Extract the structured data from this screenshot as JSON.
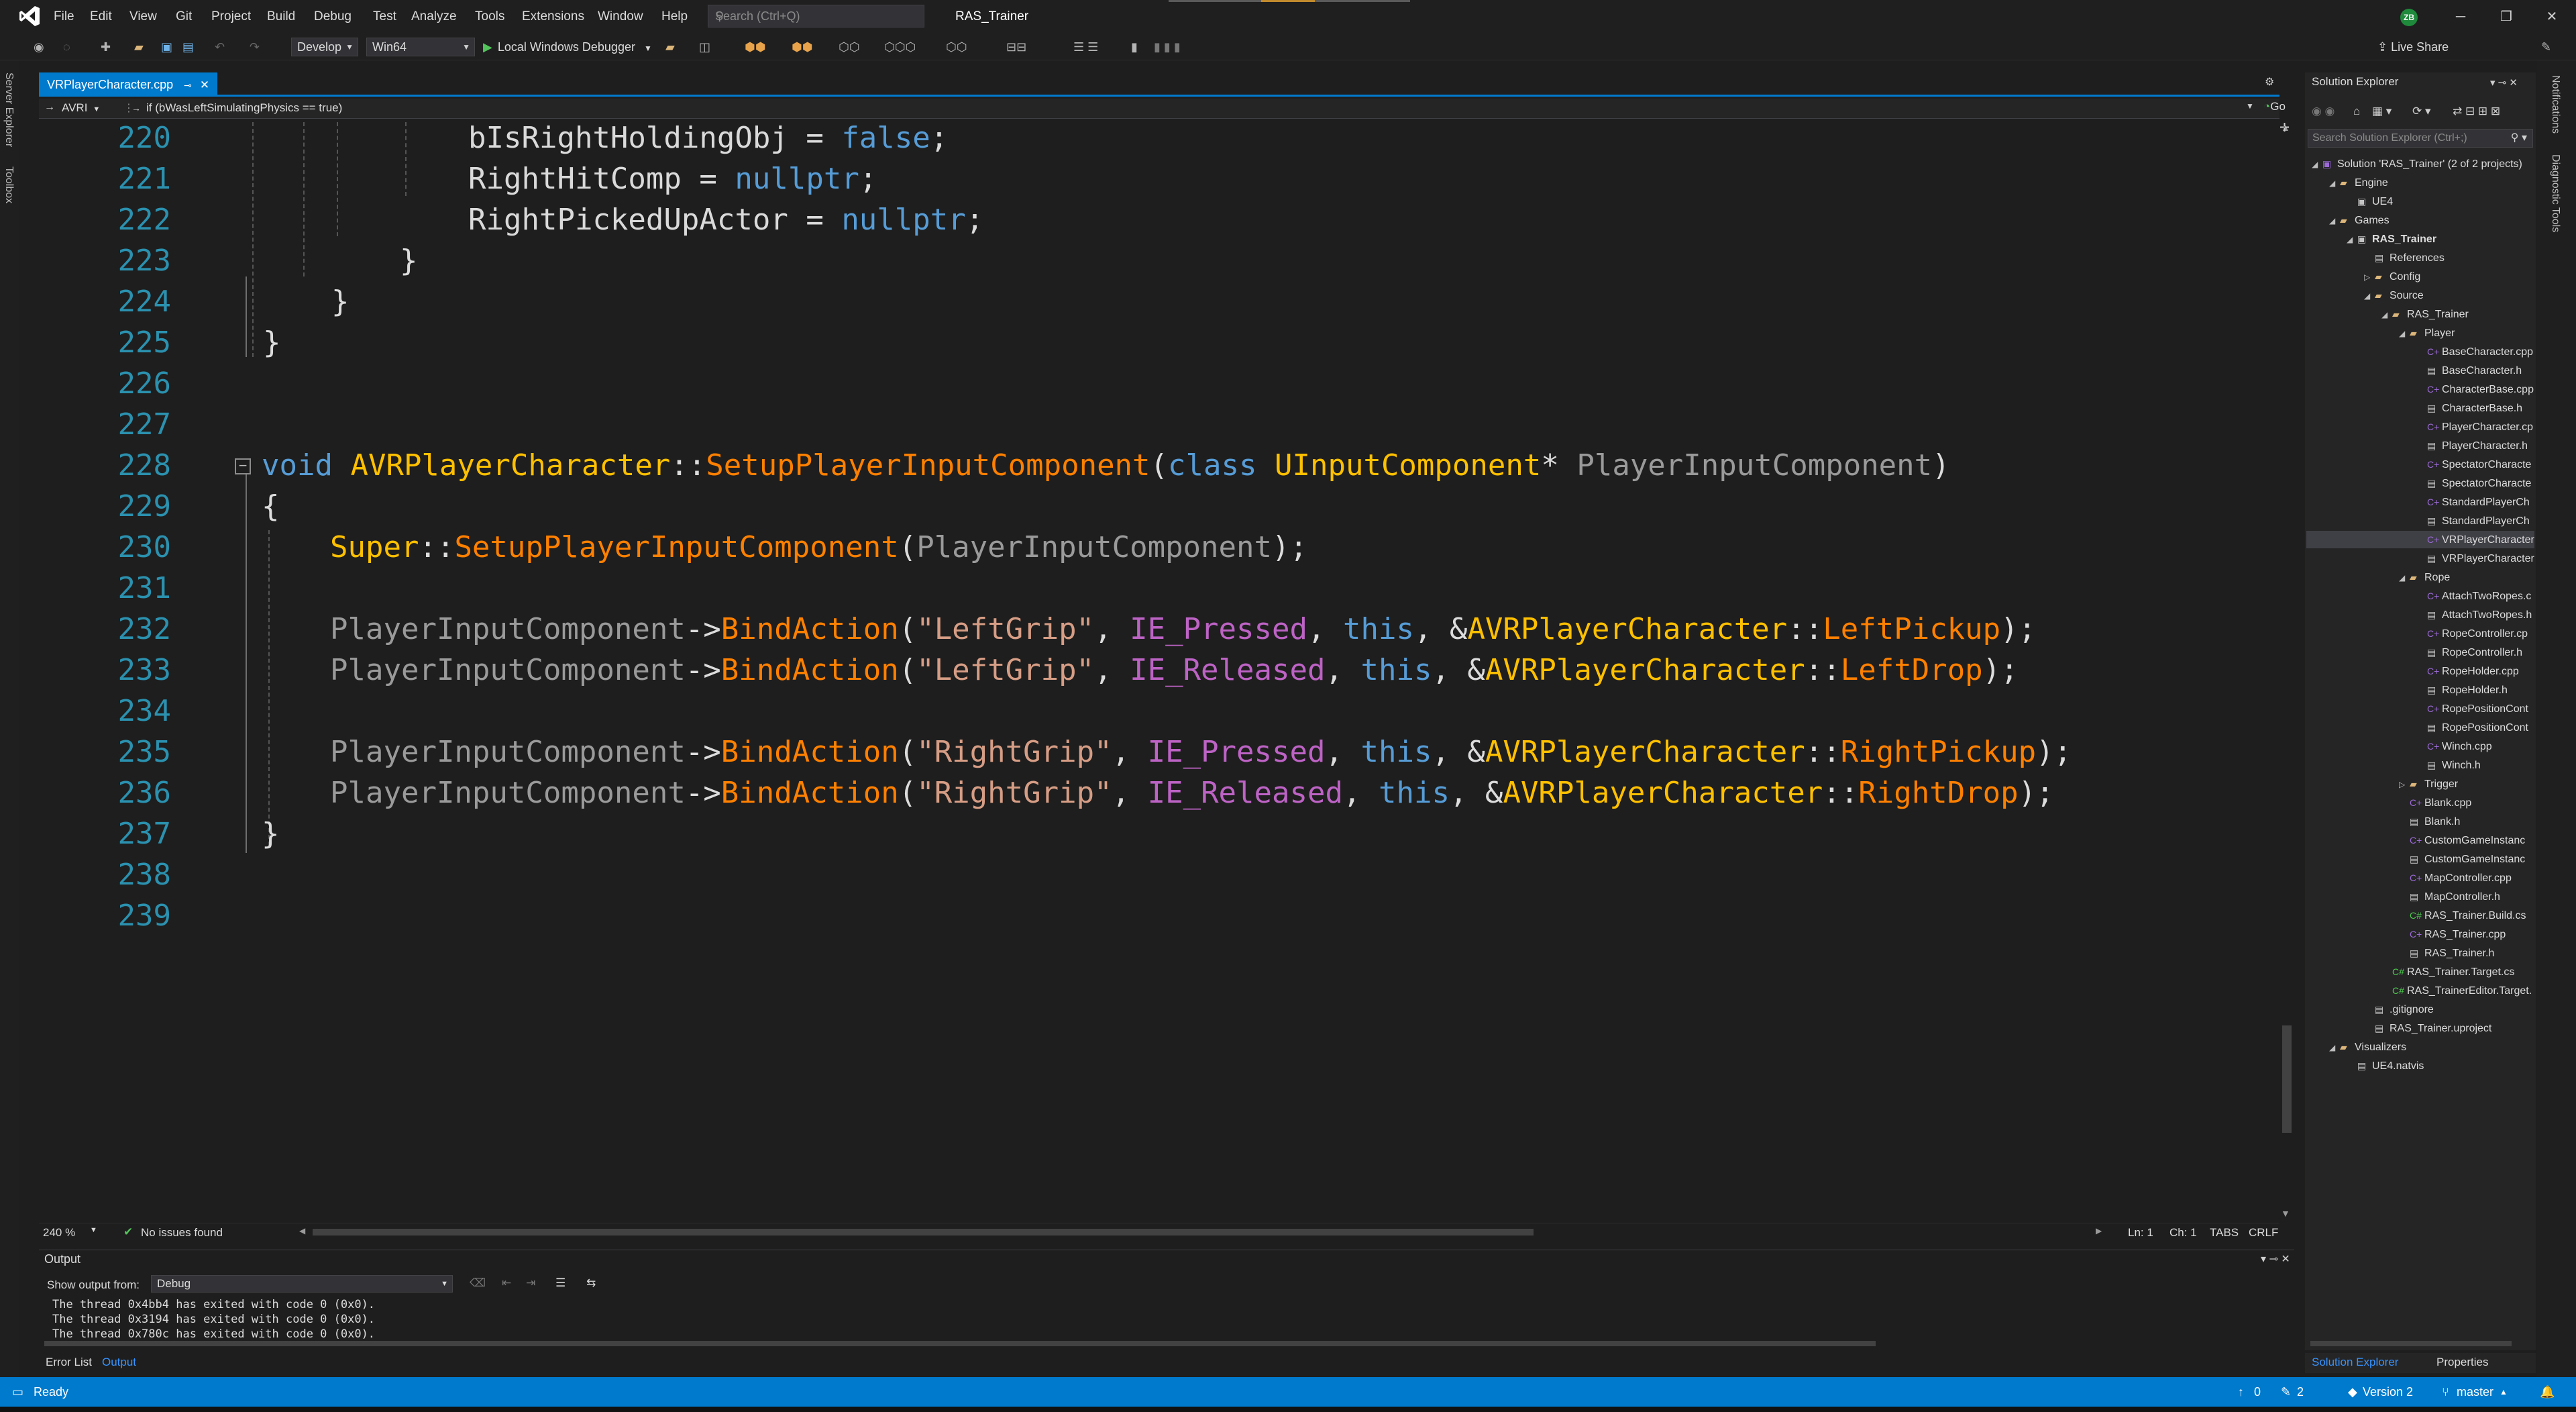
{
  "menu": [
    "File",
    "Edit",
    "View",
    "Git",
    "Project",
    "Build",
    "Debug",
    "Test",
    "Analyze",
    "Tools",
    "Extensions",
    "Window",
    "Help"
  ],
  "search": {
    "placeholder": "Search (Ctrl+Q)"
  },
  "solution_title": "RAS_Trainer",
  "user_initials": "ZB",
  "toolbar": {
    "config": "Develop",
    "platform": "Win64",
    "debugger": "Local Windows Debugger",
    "live_share": "Live Share"
  },
  "left_strip": [
    "Server Explorer",
    "Toolbox"
  ],
  "right_strip": [
    "Notifications",
    "Diagnostic Tools"
  ],
  "doc_tab": {
    "label": "VRPlayerCharacter.cpp"
  },
  "nav": {
    "scope": "AVRI",
    "member": "if (bWasLeftSimulatingPhysics == true)",
    "go": "Go"
  },
  "editor": {
    "line_numbers": [
      "220",
      "221",
      "222",
      "223",
      "224",
      "225",
      "226",
      "227",
      "228",
      "229",
      "230",
      "231",
      "232",
      "233",
      "234",
      "235",
      "236",
      "237",
      "238",
      "239"
    ],
    "zoom": "240 %",
    "issues": "No issues found",
    "position": {
      "line": "Ln: 1",
      "col": "Ch: 1",
      "indent": "TABS",
      "eol": "CRLF"
    }
  },
  "output": {
    "title": "Output",
    "show_from_label": "Show output from:",
    "source": "Debug",
    "lines": [
      "The thread 0x4bb4 has exited with code 0 (0x0).",
      "The thread 0x3194 has exited with code 0 (0x0).",
      "The thread 0x780c has exited with code 0 (0x0)."
    ]
  },
  "bottom_tabs": {
    "error_list": "Error List",
    "output": "Output"
  },
  "solution_explorer": {
    "title": "Solution Explorer",
    "search_placeholder": "Search Solution Explorer (Ctrl+;)",
    "tabs": {
      "explorer": "Solution Explorer",
      "properties": "Properties"
    },
    "tree": [
      {
        "label": "Solution 'RAS_Trainer' (2 of 2 projects)",
        "depth": 0,
        "icon": "sol"
      },
      {
        "label": "Engine",
        "depth": 1,
        "icon": "folder"
      },
      {
        "label": "UE4",
        "depth": 2,
        "icon": "proj"
      },
      {
        "label": "Games",
        "depth": 1,
        "icon": "folder"
      },
      {
        "label": "RAS_Trainer",
        "depth": 2,
        "icon": "proj",
        "bold": true
      },
      {
        "label": "References",
        "depth": 3,
        "icon": "h"
      },
      {
        "label": "Config",
        "depth": 3,
        "icon": "folder"
      },
      {
        "label": "Source",
        "depth": 3,
        "icon": "folder"
      },
      {
        "label": "RAS_Trainer",
        "depth": 4,
        "icon": "folder"
      },
      {
        "label": "Player",
        "depth": 5,
        "icon": "folder"
      },
      {
        "label": "BaseCharacter.cpp",
        "depth": 6,
        "icon": "cpp"
      },
      {
        "label": "BaseCharacter.h",
        "depth": 6,
        "icon": "h"
      },
      {
        "label": "CharacterBase.cpp",
        "depth": 6,
        "icon": "cpp"
      },
      {
        "label": "CharacterBase.h",
        "depth": 6,
        "icon": "h"
      },
      {
        "label": "PlayerCharacter.cp",
        "depth": 6,
        "icon": "cpp"
      },
      {
        "label": "PlayerCharacter.h",
        "depth": 6,
        "icon": "h"
      },
      {
        "label": "SpectatorCharacte",
        "depth": 6,
        "icon": "cpp"
      },
      {
        "label": "SpectatorCharacte",
        "depth": 6,
        "icon": "h"
      },
      {
        "label": "StandardPlayerCh",
        "depth": 6,
        "icon": "cpp"
      },
      {
        "label": "StandardPlayerCh",
        "depth": 6,
        "icon": "h"
      },
      {
        "label": "VRPlayerCharacter",
        "depth": 6,
        "icon": "cpp",
        "selected": true
      },
      {
        "label": "VRPlayerCharacter",
        "depth": 6,
        "icon": "h"
      },
      {
        "label": "Rope",
        "depth": 5,
        "icon": "folder"
      },
      {
        "label": "AttachTwoRopes.c",
        "depth": 6,
        "icon": "cpp"
      },
      {
        "label": "AttachTwoRopes.h",
        "depth": 6,
        "icon": "h"
      },
      {
        "label": "RopeController.cp",
        "depth": 6,
        "icon": "cpp"
      },
      {
        "label": "RopeController.h",
        "depth": 6,
        "icon": "h"
      },
      {
        "label": "RopeHolder.cpp",
        "depth": 6,
        "icon": "cpp"
      },
      {
        "label": "RopeHolder.h",
        "depth": 6,
        "icon": "h"
      },
      {
        "label": "RopePositionCont",
        "depth": 6,
        "icon": "cpp"
      },
      {
        "label": "RopePositionCont",
        "depth": 6,
        "icon": "h"
      },
      {
        "label": "Winch.cpp",
        "depth": 6,
        "icon": "cpp"
      },
      {
        "label": "Winch.h",
        "depth": 6,
        "icon": "h"
      },
      {
        "label": "Trigger",
        "depth": 5,
        "icon": "folder"
      },
      {
        "label": "Blank.cpp",
        "depth": 5,
        "icon": "cpp"
      },
      {
        "label": "Blank.h",
        "depth": 5,
        "icon": "h"
      },
      {
        "label": "CustomGameInstanc",
        "depth": 5,
        "icon": "cpp"
      },
      {
        "label": "CustomGameInstanc",
        "depth": 5,
        "icon": "h"
      },
      {
        "label": "MapController.cpp",
        "depth": 5,
        "icon": "cpp"
      },
      {
        "label": "MapController.h",
        "depth": 5,
        "icon": "h"
      },
      {
        "label": "RAS_Trainer.Build.cs",
        "depth": 5,
        "icon": "cs"
      },
      {
        "label": "RAS_Trainer.cpp",
        "depth": 5,
        "icon": "cpp"
      },
      {
        "label": "RAS_Trainer.h",
        "depth": 5,
        "icon": "h"
      },
      {
        "label": "RAS_Trainer.Target.cs",
        "depth": 4,
        "icon": "cs"
      },
      {
        "label": "RAS_TrainerEditor.Target.",
        "depth": 4,
        "icon": "cs"
      },
      {
        "label": ".gitignore",
        "depth": 3,
        "icon": "h"
      },
      {
        "label": "RAS_Trainer.uproject",
        "depth": 3,
        "icon": "h"
      },
      {
        "label": "Visualizers",
        "depth": 1,
        "icon": "folder"
      },
      {
        "label": "UE4.natvis",
        "depth": 2,
        "icon": "h"
      }
    ]
  },
  "statusbar": {
    "state": "Ready",
    "errors": "0",
    "changes": "2",
    "version": "Version 2",
    "branch": "master"
  },
  "colors": {
    "accent": "#007acc",
    "keyword": "#569cd6",
    "type": "#ffc000",
    "function": "#ff8000",
    "string": "#d69d85",
    "macro": "#bd63c5"
  }
}
